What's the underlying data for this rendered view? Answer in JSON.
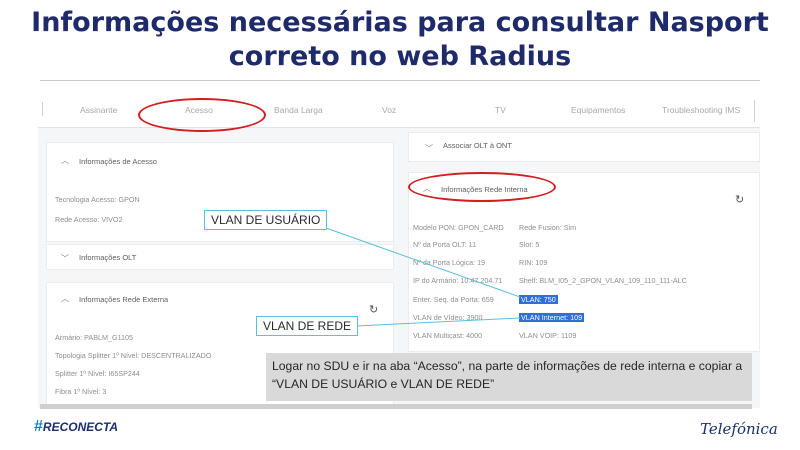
{
  "slide": {
    "title_line1": "Informações necessárias para consultar Nasport",
    "title_line2": "correto no web Radius"
  },
  "tabs": [
    "Assinante",
    "Acesso",
    "Banda Larga",
    "Voz",
    "TV",
    "Equipamentos",
    "Troubleshooting IMS"
  ],
  "left_panels": {
    "acesso": {
      "heading": "Informações de Acesso",
      "rows": [
        "Tecnologia Acesso: GPON",
        "Rede Acesso: VIVO2"
      ]
    },
    "olt": {
      "heading": "Informações OLT"
    },
    "externa": {
      "heading": "Informações Rede Externa",
      "rows": [
        "Armário: PABLM_G1105",
        "Topologia Splitter 1º Nível: DESCENTRALIZADO",
        "Splitter 1º Nível: I65SP244",
        "Fibra 1º Nível: 3"
      ]
    }
  },
  "right_panels": {
    "associar": {
      "heading": "Associar OLT à ONT"
    },
    "interna": {
      "heading": "Informações Rede Interna",
      "left_rows": [
        "Modelo PON: GPON_CARD",
        "Nº da Porta OLT: 11",
        "Nº da Porta Lógica: 19",
        "IP do Armário: 10.47.204.71",
        "Enter. Seq. da Porta: 659",
        "VLAN de Vídeo: 3900",
        "VLAN Multicast: 4000"
      ],
      "right_rows": [
        "Rede Fusion: Sim",
        "Slot: 5",
        "RIN: 109",
        "Shelf: BLM_I05_2_GPON_VLAN_109_110_111-ALC",
        "VLAN: 750",
        "VLAN Internet: 109",
        "VLAN VOIP: 1109"
      ]
    }
  },
  "callouts": {
    "vlan_usuario": "VLAN DE USUÁRIO",
    "vlan_rede": "VLAN DE REDE",
    "note": "Logar no SDU e ir na aba “Acesso”, na parte de informações de rede interna e copiar a “VLAN DE USUÁRIO e VLAN DE REDE”"
  },
  "footer": {
    "logo_left": "RECONECTA",
    "logo_left_hash": "#",
    "logo_right": "Telefónica"
  },
  "colors": {
    "title": "#1f2a6b",
    "highlight": "#2f6fd6",
    "ellipse": "#d21e1e",
    "callout_border": "#5bc0de"
  },
  "icons": [
    "chevron-up-icon",
    "chevron-down-icon",
    "refresh-icon"
  ]
}
